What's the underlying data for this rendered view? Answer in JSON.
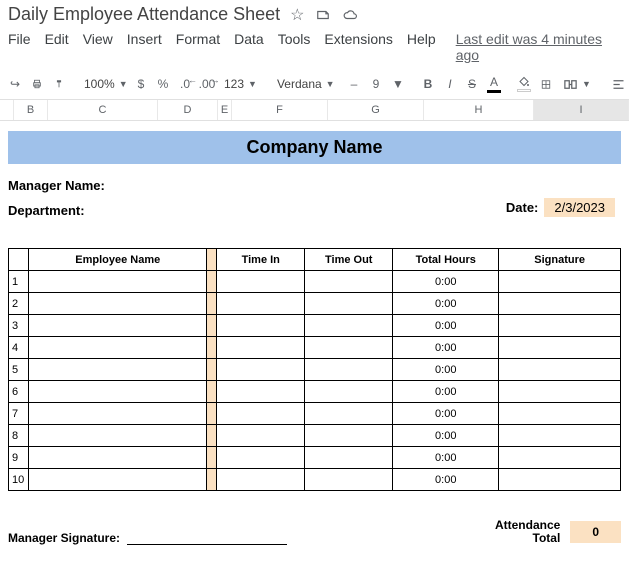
{
  "doc": {
    "title": "Daily Employee Attendance Sheet"
  },
  "menu": {
    "file": "File",
    "edit": "Edit",
    "view": "View",
    "insert": "Insert",
    "format": "Format",
    "data": "Data",
    "tools": "Tools",
    "extensions": "Extensions",
    "help": "Help",
    "lastedit": "Last edit was 4 minutes ago"
  },
  "toolbar": {
    "zoom": "100%",
    "currency": "$",
    "percent": "%",
    "decdec": ".0",
    "incdec": ".00",
    "numfmt": "123",
    "font": "Verdana",
    "size": "9",
    "bold": "B",
    "italic": "I",
    "strike": "S",
    "textcolor": "A"
  },
  "cols": {
    "b": "B",
    "c": "C",
    "d": "D",
    "e": "E",
    "f": "F",
    "g": "G",
    "h": "H",
    "i": "I"
  },
  "sheet": {
    "banner": "Company Name",
    "manager_label": "Manager Name:",
    "dept_label": "Department:",
    "date_label": "Date:",
    "date_value": "2/3/2023",
    "headers": {
      "name": "Employee Name",
      "in": "Time In",
      "out": "Time Out",
      "hrs": "Total Hours",
      "sig": "Signature"
    },
    "rows": [
      {
        "n": "1",
        "name": "",
        "in": "",
        "out": "",
        "hrs": "0:00",
        "sig": ""
      },
      {
        "n": "2",
        "name": "",
        "in": "",
        "out": "",
        "hrs": "0:00",
        "sig": ""
      },
      {
        "n": "3",
        "name": "",
        "in": "",
        "out": "",
        "hrs": "0:00",
        "sig": ""
      },
      {
        "n": "4",
        "name": "",
        "in": "",
        "out": "",
        "hrs": "0:00",
        "sig": ""
      },
      {
        "n": "5",
        "name": "",
        "in": "",
        "out": "",
        "hrs": "0:00",
        "sig": ""
      },
      {
        "n": "6",
        "name": "",
        "in": "",
        "out": "",
        "hrs": "0:00",
        "sig": ""
      },
      {
        "n": "7",
        "name": "",
        "in": "",
        "out": "",
        "hrs": "0:00",
        "sig": ""
      },
      {
        "n": "8",
        "name": "",
        "in": "",
        "out": "",
        "hrs": "0:00",
        "sig": ""
      },
      {
        "n": "9",
        "name": "",
        "in": "",
        "out": "",
        "hrs": "0:00",
        "sig": ""
      },
      {
        "n": "10",
        "name": "",
        "in": "",
        "out": "",
        "hrs": "0:00",
        "sig": ""
      }
    ],
    "mgr_sig_label": "Manager Signature:",
    "att_total_label1": "Attendance",
    "att_total_label2": "Total",
    "att_total_value": "0"
  }
}
